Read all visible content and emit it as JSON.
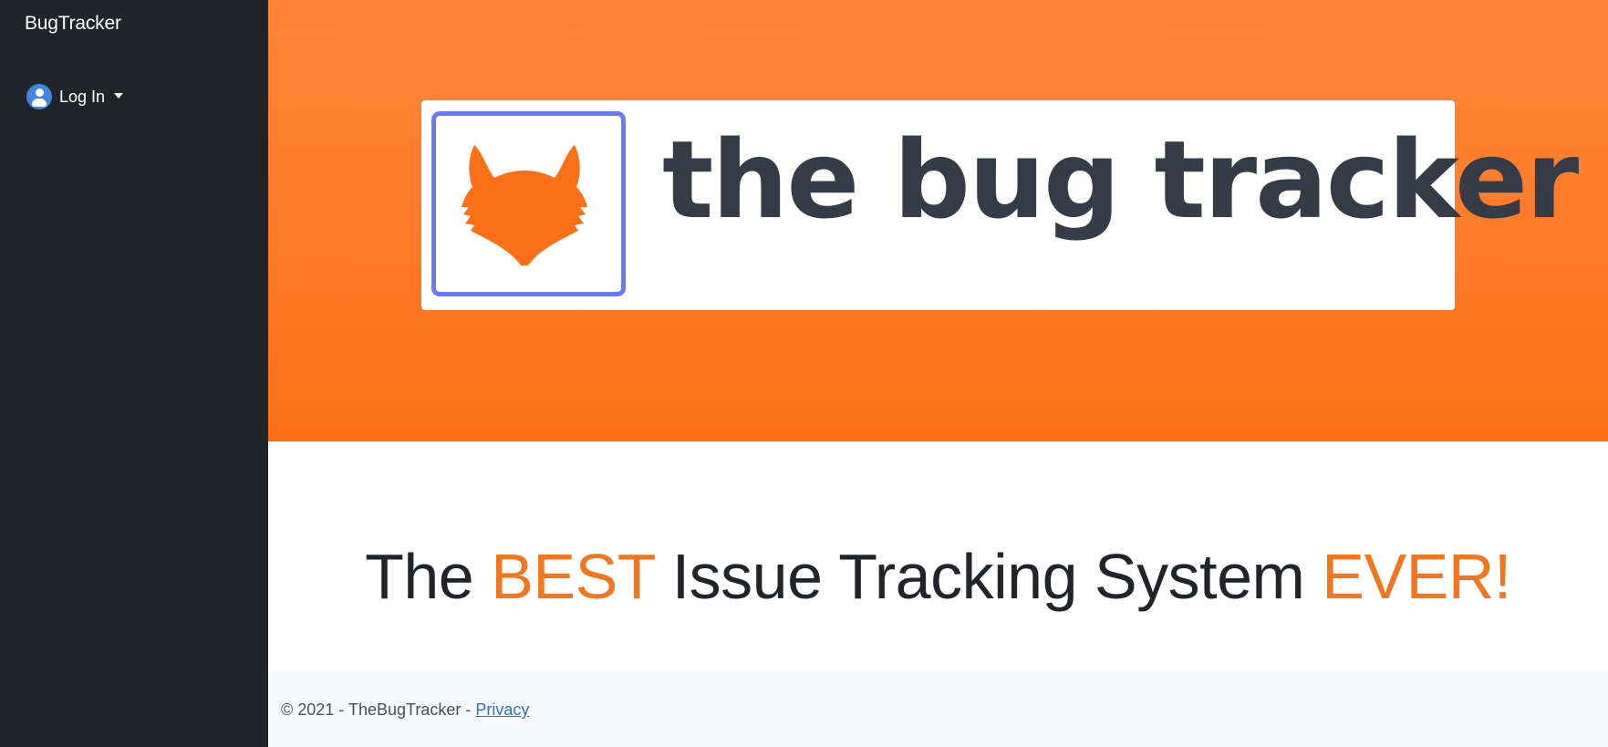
{
  "sidebar": {
    "brand": "BugTracker",
    "login": {
      "label": "Log In",
      "icon": "user-circle-icon",
      "caret_icon": "caret-down-icon"
    }
  },
  "hero": {
    "logo_text": "the bug tracker",
    "logo_icon": "fox-head-icon"
  },
  "tagline": {
    "part1": "The",
    "accent1": "BEST",
    "part2": "Issue Tracking System",
    "accent2": "EVER!"
  },
  "footer": {
    "copyright": "© 2021 - TheBugTracker - ",
    "privacy_link": "Privacy"
  },
  "colors": {
    "sidebar_bg": "#212529",
    "hero_orange": "#fd7c2a",
    "accent_orange": "#f2761f",
    "logo_border": "#6b7cf0",
    "logo_text": "#363c47",
    "link_blue": "#2a6fd6",
    "user_icon_blue": "#3f86e0"
  }
}
